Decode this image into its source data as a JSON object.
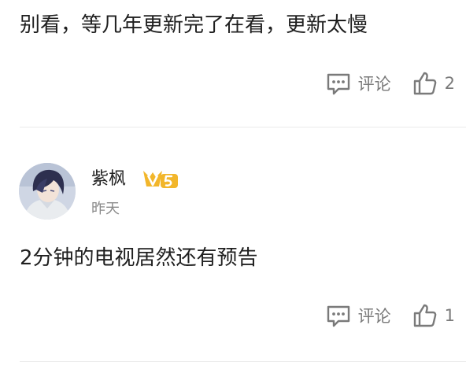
{
  "comments": [
    {
      "text": "别看，等几年更新完了在看，更新太慢",
      "comment_label": "评论",
      "like_count": "2"
    },
    {
      "username": "紫枫",
      "time": "昨天",
      "vip_level": "5",
      "text": "2分钟的电视居然还有预告",
      "comment_label": "评论",
      "like_count": "1"
    }
  ],
  "colors": {
    "text": "#1f1f1f",
    "muted": "#7a7a7a",
    "divider": "#ebebeb",
    "vip_gold": "#f2b62b"
  },
  "icons": {
    "comment": "comment-bubble-icon",
    "like": "thumbs-up-icon",
    "vip": "vip-badge-icon"
  }
}
